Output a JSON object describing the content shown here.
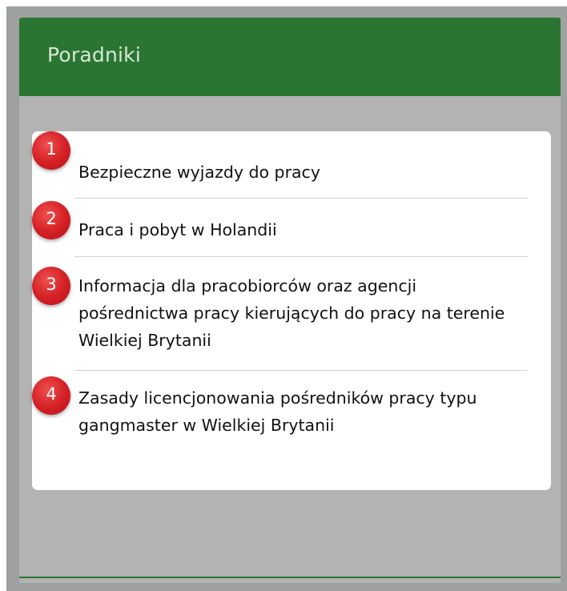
{
  "header": {
    "title": "Poradniki"
  },
  "guides": [
    {
      "number": "1",
      "title": "Bezpieczne wyjazdy do pracy"
    },
    {
      "number": "2",
      "title": "Praca i pobyt w Holandii"
    },
    {
      "number": "3",
      "title": "Informacja dla pracobiorców oraz agencji pośrednictwa pracy kierujących do pracy na terenie Wielkiej Brytanii"
    },
    {
      "number": "4",
      "title": "Zasady licencjonowania pośredników pracy typu gangmaster w Wielkiej Brytanii"
    }
  ],
  "colors": {
    "header_green": "#2b7532",
    "badge_red": "#d21f24",
    "panel_gray": "#b3b3b3"
  }
}
